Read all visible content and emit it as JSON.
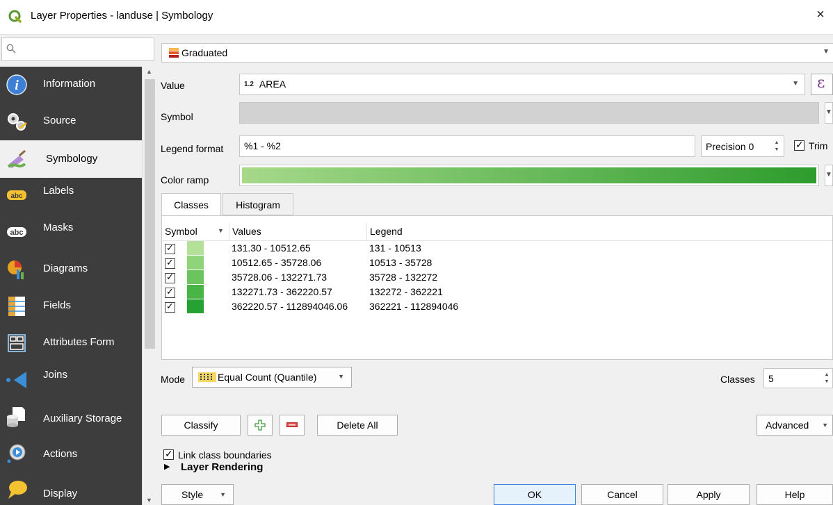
{
  "window": {
    "title": "Layer Properties - landuse | Symbology",
    "close_glyph": "×"
  },
  "sidebar": {
    "search_placeholder": "",
    "items": [
      {
        "label": "Information",
        "icon": "information-icon",
        "color": "#3d7fd4"
      },
      {
        "label": "Source",
        "icon": "source-icon",
        "color": "#d8d8d8"
      },
      {
        "label": "Symbology",
        "icon": "symbology-icon",
        "color": "#a07fd0"
      },
      {
        "label": "Labels",
        "icon": "labels-icon",
        "color": "#f2c230"
      },
      {
        "label": "Masks",
        "icon": "masks-icon",
        "color": "#ffffff"
      },
      {
        "label": "Diagrams",
        "icon": "diagrams-icon",
        "color": "#e8a020"
      },
      {
        "label": "Fields",
        "icon": "fields-icon",
        "color": "#3b8fd6"
      },
      {
        "label": "Attributes Form",
        "icon": "attributes-form-icon",
        "color": "#8ab6dc"
      },
      {
        "label": "Joins",
        "icon": "joins-icon",
        "color": "#3b8fd6"
      },
      {
        "label": "Auxiliary Storage",
        "icon": "auxiliary-storage-icon",
        "color": "#dcdcdc"
      },
      {
        "label": "Actions",
        "icon": "actions-icon",
        "color": "#3b8fd6"
      },
      {
        "label": "Display",
        "icon": "display-icon",
        "color": "#f2c230"
      }
    ],
    "active_index": 2
  },
  "renderer": {
    "label": "Graduated"
  },
  "form": {
    "value_label": "Value",
    "value_type": "1.2",
    "value_text": "AREA",
    "expression_glyph": "ε",
    "symbol_label": "Symbol",
    "legend_format_label": "Legend format",
    "legend_format_value": "%1 - %2",
    "precision_text": "Precision 0",
    "trim_label": "Trim",
    "trim_checked": true,
    "color_ramp_label": "Color ramp",
    "ramp_start": "#a6d98a",
    "ramp_end": "#2d9c2d"
  },
  "tabs": [
    {
      "label": "Classes",
      "active": true
    },
    {
      "label": "Histogram",
      "active": false
    }
  ],
  "classes_table": {
    "headers": {
      "symbol": "Symbol",
      "values": "Values",
      "legend": "Legend"
    },
    "rows": [
      {
        "checked": true,
        "color": "#b4e19a",
        "values": "131.30 - 10512.65",
        "legend": "131 - 10513"
      },
      {
        "checked": true,
        "color": "#8fd37a",
        "values": "10512.65 - 35728.06",
        "legend": "10513 - 35728"
      },
      {
        "checked": true,
        "color": "#6cc45e",
        "values": "35728.06 - 132271.73",
        "legend": "35728 - 132272"
      },
      {
        "checked": true,
        "color": "#4ab547",
        "values": "132271.73 - 362220.57",
        "legend": "132272 - 362221"
      },
      {
        "checked": true,
        "color": "#25a232",
        "values": "362220.57 - 112894046.06",
        "legend": "362221 - 112894046"
      }
    ]
  },
  "mode": {
    "label": "Mode",
    "value": "Equal Count (Quantile)",
    "classes_label": "Classes",
    "classes_value": "5"
  },
  "actions": {
    "classify": "Classify",
    "add_glyph": "+",
    "remove_glyph": "−",
    "delete_all": "Delete All",
    "advanced": "Advanced"
  },
  "link_boundaries": {
    "label": "Link class boundaries",
    "checked": true
  },
  "layer_rendering": {
    "label": "Layer Rendering"
  },
  "footer": {
    "style": "Style",
    "ok": "OK",
    "cancel": "Cancel",
    "apply": "Apply",
    "help": "Help"
  },
  "glyphs": {
    "check": "✓",
    "dropdown": "▼",
    "spin_up": "▲",
    "spin_down": "▼",
    "collapse": "▶"
  }
}
